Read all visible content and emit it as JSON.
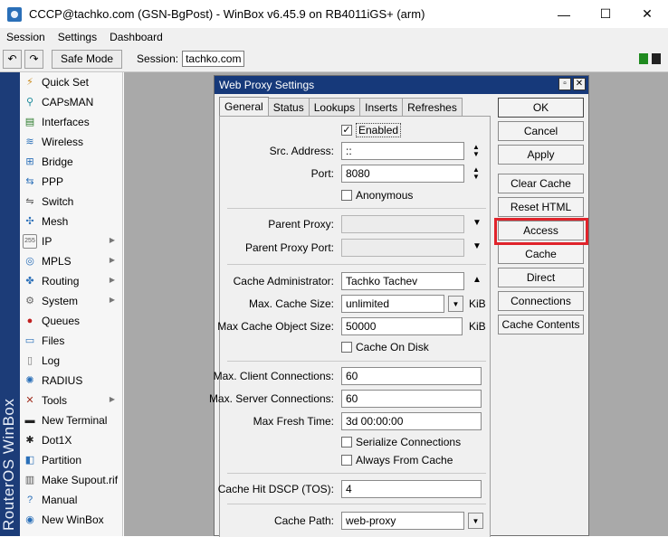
{
  "window": {
    "title": "CCCP@tachko.com (GSN-BgPost) - WinBox v6.45.9 on RB4011iGS+ (arm)",
    "minimize": "—",
    "maximize": "☐",
    "close": "✕"
  },
  "menu": [
    "Session",
    "Settings",
    "Dashboard"
  ],
  "toolbar": {
    "undo": "↶",
    "redo": "↷",
    "safe_mode": "Safe Mode",
    "session_label": "Session:",
    "session_value": "tachko.com"
  },
  "brand": "RouterOS WinBox",
  "sidebar": [
    {
      "label": "Quick Set",
      "icon": "quick-set-icon",
      "glyph": "⚡",
      "color": "#c98a1b",
      "submenu": false
    },
    {
      "label": "CAPsMAN",
      "icon": "capsman-icon",
      "glyph": "⚲",
      "color": "#1b8a9a",
      "submenu": false
    },
    {
      "label": "Interfaces",
      "icon": "interfaces-icon",
      "glyph": "▤",
      "color": "#2a7a2a",
      "submenu": false
    },
    {
      "label": "Wireless",
      "icon": "wireless-icon",
      "glyph": "≋",
      "color": "#2a6fb8",
      "submenu": false
    },
    {
      "label": "Bridge",
      "icon": "bridge-icon",
      "glyph": "⊞",
      "color": "#2a6fb8",
      "submenu": false
    },
    {
      "label": "PPP",
      "icon": "ppp-icon",
      "glyph": "⇆",
      "color": "#2a6fb8",
      "submenu": false
    },
    {
      "label": "Switch",
      "icon": "switch-icon",
      "glyph": "⇋",
      "color": "#555555",
      "submenu": false
    },
    {
      "label": "Mesh",
      "icon": "mesh-icon",
      "glyph": "✣",
      "color": "#2a6fb8",
      "submenu": false
    },
    {
      "label": "IP",
      "icon": "ip-icon",
      "glyph": "255",
      "color": "#555555",
      "submenu": true
    },
    {
      "label": "MPLS",
      "icon": "mpls-icon",
      "glyph": "◎",
      "color": "#2a6fb8",
      "submenu": true
    },
    {
      "label": "Routing",
      "icon": "routing-icon",
      "glyph": "✤",
      "color": "#2a6fb8",
      "submenu": true
    },
    {
      "label": "System",
      "icon": "system-icon",
      "glyph": "⚙",
      "color": "#666666",
      "submenu": true
    },
    {
      "label": "Queues",
      "icon": "queues-icon",
      "glyph": "●",
      "color": "#c02020",
      "submenu": false
    },
    {
      "label": "Files",
      "icon": "files-icon",
      "glyph": "▭",
      "color": "#2a6fb8",
      "submenu": false
    },
    {
      "label": "Log",
      "icon": "log-icon",
      "glyph": "▯",
      "color": "#777777",
      "submenu": false
    },
    {
      "label": "RADIUS",
      "icon": "radius-icon",
      "glyph": "✺",
      "color": "#2a6fb8",
      "submenu": false
    },
    {
      "label": "Tools",
      "icon": "tools-icon",
      "glyph": "✕",
      "color": "#a03020",
      "submenu": true
    },
    {
      "label": "New Terminal",
      "icon": "terminal-icon",
      "glyph": "▬",
      "color": "#222222",
      "submenu": false
    },
    {
      "label": "Dot1X",
      "icon": "dot1x-icon",
      "glyph": "✱",
      "color": "#222222",
      "submenu": false
    },
    {
      "label": "Partition",
      "icon": "partition-icon",
      "glyph": "◧",
      "color": "#2a6fb8",
      "submenu": false
    },
    {
      "label": "Make Supout.rif",
      "icon": "supout-icon",
      "glyph": "▥",
      "color": "#555555",
      "submenu": false
    },
    {
      "label": "Manual",
      "icon": "manual-icon",
      "glyph": "?",
      "color": "#2a6fb8",
      "submenu": false
    },
    {
      "label": "New WinBox",
      "icon": "winbox-icon",
      "glyph": "◉",
      "color": "#2a6fb8",
      "submenu": false
    }
  ],
  "dialog": {
    "title": "Web Proxy Settings",
    "tabs": [
      "General",
      "Status",
      "Lookups",
      "Inserts",
      "Refreshes"
    ],
    "active_tab": "General",
    "enabled_label": "Enabled",
    "enabled_checked": true,
    "src_address_label": "Src. Address:",
    "src_address_value": "::",
    "port_label": "Port:",
    "port_value": "8080",
    "anonymous_label": "Anonymous",
    "anonymous_checked": false,
    "parent_proxy_label": "Parent Proxy:",
    "parent_proxy_value": "",
    "parent_proxy_port_label": "Parent Proxy Port:",
    "parent_proxy_port_value": "",
    "cache_admin_label": "Cache Administrator:",
    "cache_admin_value": "Tachko Tachev",
    "max_cache_size_label": "Max. Cache Size:",
    "max_cache_size_value": "unlimited",
    "max_cache_size_unit": "KiB",
    "max_cache_obj_label": "Max Cache Object Size:",
    "max_cache_obj_value": "50000",
    "max_cache_obj_unit": "KiB",
    "cache_on_disk_label": "Cache On Disk",
    "cache_on_disk_checked": false,
    "max_client_conn_label": "Max. Client Connections:",
    "max_client_conn_value": "60",
    "max_server_conn_label": "Max. Server Connections:",
    "max_server_conn_value": "60",
    "max_fresh_time_label": "Max Fresh Time:",
    "max_fresh_time_value": "3d 00:00:00",
    "serialize_conn_label": "Serialize Connections",
    "serialize_conn_checked": false,
    "always_from_cache_label": "Always From Cache",
    "always_from_cache_checked": false,
    "cache_hit_dscp_label": "Cache Hit DSCP (TOS):",
    "cache_hit_dscp_value": "4",
    "cache_path_label": "Cache Path:",
    "cache_path_value": "web-proxy",
    "buttons": {
      "ok": "OK",
      "cancel": "Cancel",
      "apply": "Apply",
      "clear_cache": "Clear Cache",
      "reset_html": "Reset HTML",
      "access": "Access",
      "cache": "Cache",
      "direct": "Direct",
      "connections": "Connections",
      "cache_contents": "Cache Contents"
    },
    "highlight_color": "#e0232b"
  }
}
